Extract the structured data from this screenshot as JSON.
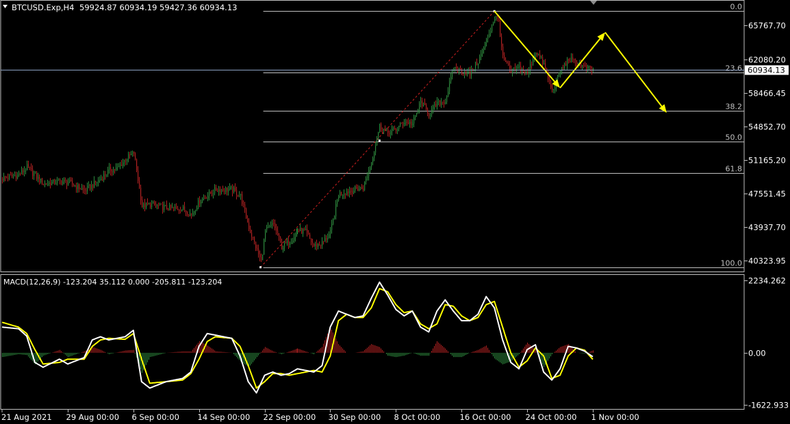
{
  "header": {
    "symbol_text": "BTCUSD.Exp,H4",
    "ohlc_text": "59924.87 60934.19 59427.36 60934.13",
    "macd_text": "MACD(12,26,9) -123.204 35.112 0.000 -205.811 -123.204"
  },
  "colors": {
    "bull": "#2e8b3e",
    "bear": "#b22222",
    "arrow": "#ffff00",
    "macd_line": "#ffffff",
    "signal_line": "#ffff00",
    "fib": "#c0c0c0",
    "bid_line": "#8ea3c6",
    "axis": "#c0c0c0"
  },
  "chart_data": [
    {
      "type": "candlestick",
      "title": "BTCUSD.Exp,H4",
      "last_price": "60934.13",
      "y_ticks": [
        "65767.70",
        "62080.20",
        "58466.45",
        "54852.70",
        "51165.20",
        "47551.45",
        "43937.70",
        "40323.95"
      ],
      "x_ticks": [
        "21 Aug 2021",
        "29 Aug 00:00",
        "6 Sep 00:00",
        "14 Sep 00:00",
        "22 Sep 00:00",
        "30 Sep 00:00",
        "8 Oct 00:00",
        "16 Oct 00:00",
        "24 Oct 00:00",
        "1 Nov 00:00"
      ],
      "fib_levels": [
        {
          "label": "0.0",
          "price": 67300
        },
        {
          "label": "23.6",
          "price": 60650
        },
        {
          "label": "38.2",
          "price": 56500
        },
        {
          "label": "50.0",
          "price": 53200
        },
        {
          "label": "61.8",
          "price": 49800
        },
        {
          "label": "100.0",
          "price": 39600
        }
      ],
      "price_path": [
        [
          "21 Aug 2021",
          49200
        ],
        [
          "23 Aug",
          49600
        ],
        [
          "24 Aug",
          50400
        ],
        [
          "26 Aug",
          48600
        ],
        [
          "28 Aug",
          48900
        ],
        [
          "29 Aug",
          48800
        ],
        [
          "31 Aug",
          47900
        ],
        [
          "1 Sep",
          48500
        ],
        [
          "2 Sep",
          49200
        ],
        [
          "3 Sep",
          50100
        ],
        [
          "4 Sep",
          50300
        ],
        [
          "5 Sep",
          51300
        ],
        [
          "6 Sep",
          52000
        ],
        [
          "7 Sep",
          46200
        ],
        [
          "8 Sep",
          46400
        ],
        [
          "10 Sep",
          46000
        ],
        [
          "12 Sep",
          45900
        ],
        [
          "13 Sep",
          45300
        ],
        [
          "14 Sep",
          46800
        ],
        [
          "16 Sep",
          48000
        ],
        [
          "18 Sep",
          48000
        ],
        [
          "19 Sep",
          47300
        ],
        [
          "20 Sep",
          43900
        ],
        [
          "21 Sep",
          41400
        ],
        [
          "21.5 Sep",
          40200
        ],
        [
          "22 Sep",
          43500
        ],
        [
          "23 Sep",
          44300
        ],
        [
          "24 Sep",
          41800
        ],
        [
          "25 Sep",
          42400
        ],
        [
          "26 Sep",
          43600
        ],
        [
          "27 Sep",
          43400
        ],
        [
          "28 Sep",
          41900
        ],
        [
          "29 Sep",
          42200
        ],
        [
          "30 Sep",
          43300
        ],
        [
          "1 Oct",
          47500
        ],
        [
          "2 Oct",
          47800
        ],
        [
          "3 Oct",
          48000
        ],
        [
          "4 Oct",
          48200
        ],
        [
          "5 Oct",
          51000
        ],
        [
          "6 Oct",
          54900
        ],
        [
          "7 Oct",
          54200
        ],
        [
          "8 Oct",
          54500
        ],
        [
          "9 Oct",
          55400
        ],
        [
          "10 Oct",
          55100
        ],
        [
          "11 Oct",
          57500
        ],
        [
          "12 Oct",
          56200
        ],
        [
          "13 Oct",
          57300
        ],
        [
          "14 Oct",
          57600
        ],
        [
          "15 Oct",
          61200
        ],
        [
          "16 Oct",
          60800
        ],
        [
          "17 Oct",
          60500
        ],
        [
          "18 Oct",
          61900
        ],
        [
          "19 Oct",
          64100
        ],
        [
          "20 Oct",
          66600
        ],
        [
          "20.5 Oct",
          66200
        ],
        [
          "21 Oct",
          62200
        ],
        [
          "22 Oct",
          60700
        ],
        [
          "23 Oct",
          61200
        ],
        [
          "24 Oct",
          60500
        ],
        [
          "25 Oct",
          63000
        ],
        [
          "26 Oct",
          61500
        ],
        [
          "27 Oct",
          58600
        ],
        [
          "28 Oct",
          60800
        ],
        [
          "29 Oct",
          62100
        ],
        [
          "30 Oct",
          61700
        ],
        [
          "31 Oct",
          61200
        ],
        [
          "1 Nov",
          60934
        ]
      ],
      "projection_arrows": [
        [
          [
            "20 Oct",
            67300
          ],
          [
            "28 Oct",
            59000
          ]
        ],
        [
          [
            "28 Oct",
            59000
          ],
          [
            "2.5 Nov",
            65000
          ]
        ],
        [
          [
            "2.5 Nov",
            65000
          ],
          [
            "10 Nov",
            56300
          ]
        ]
      ]
    },
    {
      "type": "histogram+line",
      "title": "MACD(12,26,9)",
      "y_ticks": [
        "2234.262",
        "0.00",
        "-1622.933"
      ],
      "macd": [
        [
          "21 Aug 2021",
          800
        ],
        [
          "23 Aug",
          750
        ],
        [
          "24 Aug",
          520
        ],
        [
          "25 Aug",
          -300
        ],
        [
          "26 Aug",
          -450
        ],
        [
          "28 Aug",
          -200
        ],
        [
          "29 Aug",
          -350
        ],
        [
          "31 Aug",
          -150
        ],
        [
          "1 Sep",
          400
        ],
        [
          "2 Sep",
          500
        ],
        [
          "3 Sep",
          400
        ],
        [
          "5 Sep",
          500
        ],
        [
          "6 Sep",
          700
        ],
        [
          "7 Sep",
          -900
        ],
        [
          "8 Sep",
          -1100
        ],
        [
          "10 Sep",
          -900
        ],
        [
          "12 Sep",
          -800
        ],
        [
          "13 Sep",
          -600
        ],
        [
          "14 Sep",
          200
        ],
        [
          "15 Sep",
          600
        ],
        [
          "16 Sep",
          550
        ],
        [
          "18 Sep",
          450
        ],
        [
          "19 Sep",
          -100
        ],
        [
          "20 Sep",
          -900
        ],
        [
          "21 Sep",
          -1250
        ],
        [
          "22 Sep",
          -700
        ],
        [
          "23 Sep",
          -600
        ],
        [
          "24 Sep",
          -700
        ],
        [
          "25 Sep",
          -650
        ],
        [
          "26 Sep",
          -500
        ],
        [
          "28 Sep",
          -600
        ],
        [
          "29 Sep",
          -400
        ],
        [
          "30 Sep",
          800
        ],
        [
          "1 Oct",
          1300
        ],
        [
          "2 Oct",
          1200
        ],
        [
          "3 Oct",
          1100
        ],
        [
          "4 Oct",
          1150
        ],
        [
          "5 Oct",
          1700
        ],
        [
          "6 Oct",
          2200
        ],
        [
          "7 Oct",
          1800
        ],
        [
          "8 Oct",
          1350
        ],
        [
          "9 Oct",
          1150
        ],
        [
          "10 Oct",
          1300
        ],
        [
          "11 Oct",
          800
        ],
        [
          "12 Oct",
          650
        ],
        [
          "13 Oct",
          1300
        ],
        [
          "14 Oct",
          1650
        ],
        [
          "15 Oct",
          1300
        ],
        [
          "16 Oct",
          1000
        ],
        [
          "17 Oct",
          1000
        ],
        [
          "18 Oct",
          1200
        ],
        [
          "19 Oct",
          1750
        ],
        [
          "20 Oct",
          1400
        ],
        [
          "21 Oct",
          400
        ],
        [
          "22 Oct",
          -300
        ],
        [
          "23 Oct",
          -500
        ],
        [
          "24 Oct",
          100
        ],
        [
          "25 Oct",
          250
        ],
        [
          "26 Oct",
          -600
        ],
        [
          "27 Oct",
          -850
        ],
        [
          "28 Oct",
          -500
        ],
        [
          "29 Oct",
          200
        ],
        [
          "30 Oct",
          150
        ],
        [
          "31 Oct",
          50
        ],
        [
          "1 Nov",
          -123
        ]
      ],
      "signal": [
        [
          "21 Aug 2021",
          950
        ],
        [
          "23 Aug",
          800
        ],
        [
          "24 Aug",
          600
        ],
        [
          "25 Aug",
          100
        ],
        [
          "26 Aug",
          -350
        ],
        [
          "28 Aug",
          -300
        ],
        [
          "29 Aug",
          -200
        ],
        [
          "31 Aug",
          -200
        ],
        [
          "1 Sep",
          200
        ],
        [
          "2 Sep",
          400
        ],
        [
          "3 Sep",
          450
        ],
        [
          "5 Sep",
          420
        ],
        [
          "6 Sep",
          600
        ],
        [
          "7 Sep",
          -200
        ],
        [
          "8 Sep",
          -950
        ],
        [
          "10 Sep",
          -900
        ],
        [
          "12 Sep",
          -850
        ],
        [
          "13 Sep",
          -650
        ],
        [
          "14 Sep",
          -200
        ],
        [
          "15 Sep",
          350
        ],
        [
          "16 Sep",
          500
        ],
        [
          "18 Sep",
          450
        ],
        [
          "19 Sep",
          200
        ],
        [
          "20 Sep",
          -400
        ],
        [
          "21 Sep",
          -1100
        ],
        [
          "22 Sep",
          -900
        ],
        [
          "23 Sep",
          -650
        ],
        [
          "24 Sep",
          -650
        ],
        [
          "25 Sep",
          -700
        ],
        [
          "26 Sep",
          -650
        ],
        [
          "28 Sep",
          -550
        ],
        [
          "29 Sep",
          -600
        ],
        [
          "30 Sep",
          -100
        ],
        [
          "1 Oct",
          1000
        ],
        [
          "2 Oct",
          1200
        ],
        [
          "3 Oct",
          1100
        ],
        [
          "4 Oct",
          1100
        ],
        [
          "5 Oct",
          1400
        ],
        [
          "6 Oct",
          2000
        ],
        [
          "7 Oct",
          1900
        ],
        [
          "8 Oct",
          1500
        ],
        [
          "9 Oct",
          1250
        ],
        [
          "10 Oct",
          1300
        ],
        [
          "11 Oct",
          900
        ],
        [
          "12 Oct",
          750
        ],
        [
          "13 Oct",
          900
        ],
        [
          "14 Oct",
          1500
        ],
        [
          "15 Oct",
          1450
        ],
        [
          "16 Oct",
          1150
        ],
        [
          "17 Oct",
          1000
        ],
        [
          "18 Oct",
          1100
        ],
        [
          "19 Oct",
          1500
        ],
        [
          "20 Oct",
          1600
        ],
        [
          "21 Oct",
          800
        ],
        [
          "22 Oct",
          0
        ],
        [
          "23 Oct",
          -450
        ],
        [
          "24 Oct",
          -250
        ],
        [
          "25 Oct",
          150
        ],
        [
          "26 Oct",
          -100
        ],
        [
          "27 Oct",
          -800
        ],
        [
          "28 Oct",
          -700
        ],
        [
          "29 Oct",
          -100
        ],
        [
          "30 Oct",
          150
        ],
        [
          "31 Oct",
          80
        ],
        [
          "1 Nov",
          -206
        ]
      ]
    }
  ]
}
